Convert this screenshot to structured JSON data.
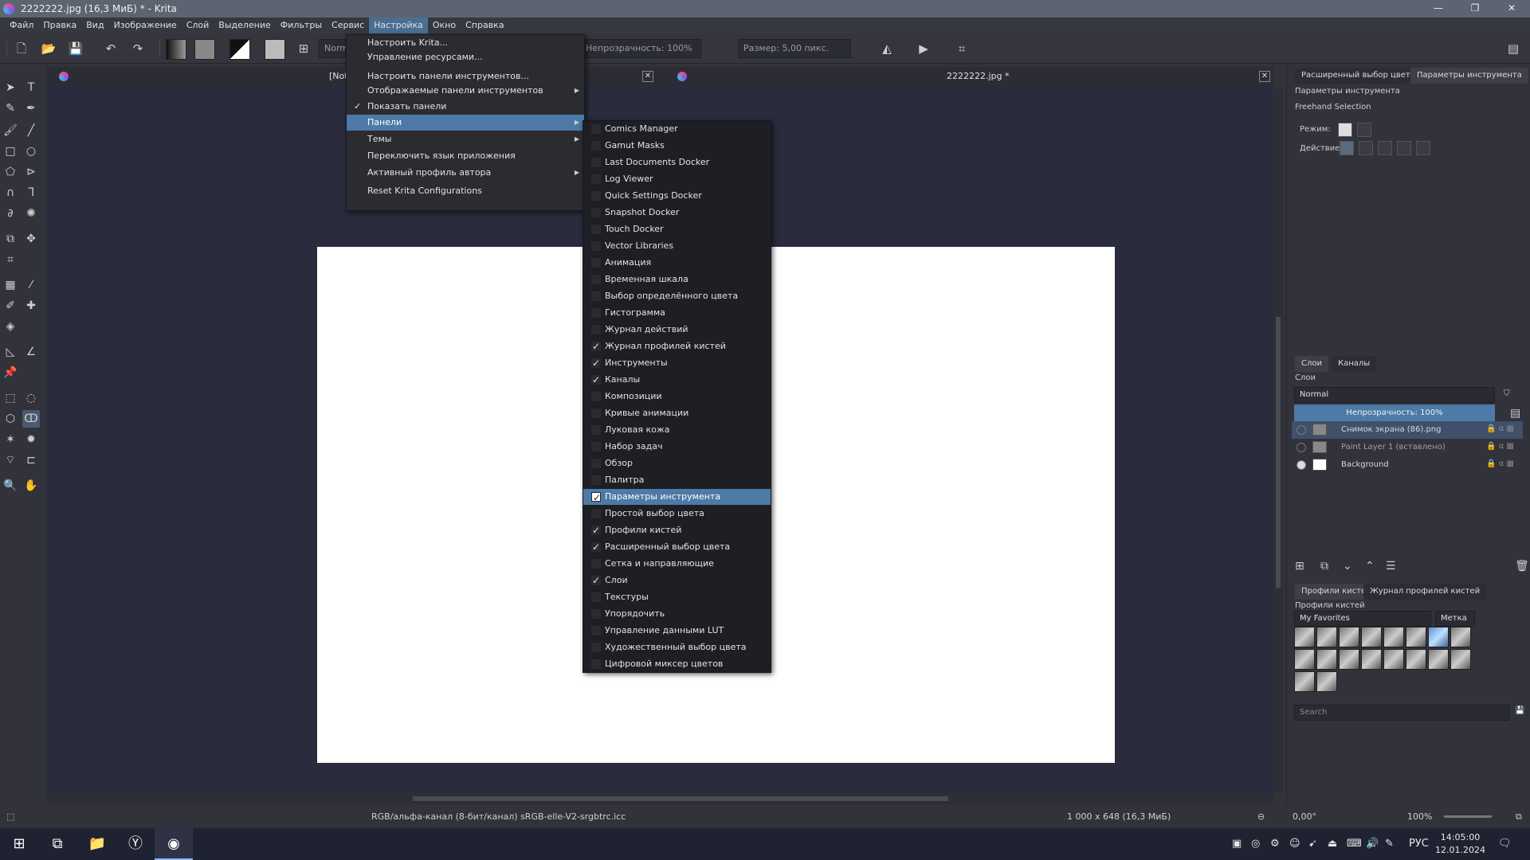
{
  "window": {
    "title": "2222222.jpg (16,3 МиБ)  * - Krita",
    "minimize": "—",
    "maximize": "❐",
    "close": "✕"
  },
  "menubar": {
    "items": [
      "Файл",
      "Правка",
      "Вид",
      "Изображение",
      "Слой",
      "Выделение",
      "Фильтры",
      "Сервис",
      "Настройка",
      "Окно",
      "Справка"
    ],
    "active_index": 8
  },
  "toolbar": {
    "blend_mode": "Norm",
    "opacity": "Непрозрачность: 100%",
    "size": "Размер: 5,00 пикс."
  },
  "tabs": {
    "first_label": "[Not",
    "second_label": "2222222.jpg *"
  },
  "settings_menu": {
    "items": [
      {
        "label": "Настроить Krita...",
        "arrow": "",
        "check": ""
      },
      {
        "label": "Управление ресурсами...",
        "arrow": "",
        "check": ""
      },
      {
        "label": "Настроить панели инструментов...",
        "arrow": "",
        "check": ""
      },
      {
        "label": "Отображаемые панели инструментов",
        "arrow": "▶",
        "check": ""
      },
      {
        "label": "Показать панели",
        "arrow": "",
        "check": "✓"
      },
      {
        "label": "Панели",
        "arrow": "▶",
        "check": ""
      },
      {
        "label": "Темы",
        "arrow": "▶",
        "check": ""
      },
      {
        "label": "Переключить язык приложения",
        "arrow": "",
        "check": ""
      },
      {
        "label": "Активный профиль автора",
        "arrow": "▶",
        "check": ""
      },
      {
        "label": "Reset Krita Configurations",
        "arrow": "",
        "check": ""
      }
    ],
    "highlighted_index": 5
  },
  "dockers_menu": {
    "items": [
      {
        "label": "Comics Manager",
        "checked": false
      },
      {
        "label": "Gamut Masks",
        "checked": false
      },
      {
        "label": "Last Documents Docker",
        "checked": false
      },
      {
        "label": "Log Viewer",
        "checked": false
      },
      {
        "label": "Quick Settings Docker",
        "checked": false
      },
      {
        "label": "Snapshot Docker",
        "checked": false
      },
      {
        "label": "Touch Docker",
        "checked": false
      },
      {
        "label": "Vector Libraries",
        "checked": false
      },
      {
        "label": "Анимация",
        "checked": false
      },
      {
        "label": "Временная шкала",
        "checked": false
      },
      {
        "label": "Выбор определённого цвета",
        "checked": false
      },
      {
        "label": "Гистограмма",
        "checked": false
      },
      {
        "label": "Журнал действий",
        "checked": false
      },
      {
        "label": "Журнал профилей кистей",
        "checked": true
      },
      {
        "label": "Инструменты",
        "checked": true
      },
      {
        "label": "Каналы",
        "checked": true
      },
      {
        "label": "Композиции",
        "checked": false
      },
      {
        "label": "Кривые анимации",
        "checked": false
      },
      {
        "label": "Луковая кожа",
        "checked": false
      },
      {
        "label": "Набор задач",
        "checked": false
      },
      {
        "label": "Обзор",
        "checked": false
      },
      {
        "label": "Палитра",
        "checked": false
      },
      {
        "label": "Параметры инструмента",
        "checked": true
      },
      {
        "label": "Простой выбор цвета",
        "checked": false
      },
      {
        "label": "Профили кистей",
        "checked": true
      },
      {
        "label": "Расширенный выбор цвета",
        "checked": true
      },
      {
        "label": "Сетка и направляющие",
        "checked": false
      },
      {
        "label": "Слои",
        "checked": true
      },
      {
        "label": "Текстуры",
        "checked": false
      },
      {
        "label": "Упорядочить",
        "checked": false
      },
      {
        "label": "Управление данными LUT",
        "checked": false
      },
      {
        "label": "Художественный выбор цвета",
        "checked": false
      },
      {
        "label": "Цифровой миксер цветов",
        "checked": false
      }
    ],
    "highlighted_index": 22
  },
  "right_panel": {
    "top_tabs": [
      "Расширенный выбор цвета",
      "Параметры инструмента"
    ],
    "tool_options_title": "Параметры инструмента",
    "tool_name": "Freehand Selection",
    "mode_label": "Режим:",
    "action_label": "Действие:",
    "layer_tabs": [
      "Слои",
      "Каналы"
    ],
    "layers_title": "Слои",
    "blend_mode": "Normal",
    "opacity": "Непрозрачность:  100%",
    "layers": [
      {
        "name": "Снимок экрана (86).png",
        "selected": true,
        "visible": false,
        "dim": false
      },
      {
        "name": "Paint Layer 1 (вставлено)",
        "selected": false,
        "visible": false,
        "dim": true
      },
      {
        "name": "Background",
        "selected": false,
        "visible": true,
        "dim": false
      }
    ],
    "brush_tabs": [
      "Профили кистей",
      "Журнал профилей кистей"
    ],
    "brush_title": "Профили кистей",
    "brush_tag": "My Favorites",
    "brush_tag_button": "Метка",
    "search_placeholder": "Search"
  },
  "status": {
    "color_profile": "RGB/альфа-канал (8-бит/канал)  sRGB-elle-V2-srgbtrc.icc",
    "dimensions": "1 000 x 648 (16,3 МиБ)",
    "rotation": "0,00°",
    "zoom": "100%"
  },
  "taskbar": {
    "lang": "РУС",
    "time": "14:05:00",
    "date": "12.01.2024"
  },
  "colors": {
    "accent": "#4d7aa6",
    "canvas_bg": "#2a2b3d",
    "panel_bg": "#31323a"
  }
}
